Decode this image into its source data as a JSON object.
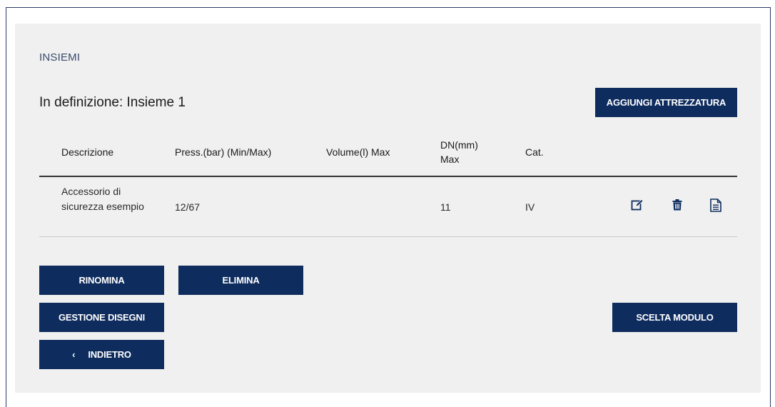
{
  "section": {
    "title": "INSIEMI"
  },
  "header": {
    "subtitle": "In definizione: Insieme 1",
    "add_button": "AGGIUNGI ATTREZZATURA"
  },
  "table": {
    "columns": {
      "descrizione": "Descrizione",
      "press": "Press.(bar) (Min/Max)",
      "volume": "Volume(l) Max",
      "dn": "DN(mm) Max",
      "cat": "Cat."
    },
    "rows": [
      {
        "descrizione": "Accessorio di sicurezza esempio",
        "press": "12/67",
        "volume": "",
        "dn": "11",
        "cat": "IV",
        "actions": [
          "edit-icon",
          "trash-icon",
          "document-icon"
        ]
      }
    ]
  },
  "actions": {
    "rinomina": "RINOMINA",
    "elimina": "ELIMINA",
    "gestione_disegni": "GESTIONE DISEGNI",
    "indietro_chevron": "‹",
    "indietro": "INDIETRO",
    "scelta_modulo": "SCELTA MODULO"
  },
  "colors": {
    "button_bg": "#0e2c5e",
    "panel_bg": "#f0f0f0",
    "icon": "#0e2c5e"
  }
}
